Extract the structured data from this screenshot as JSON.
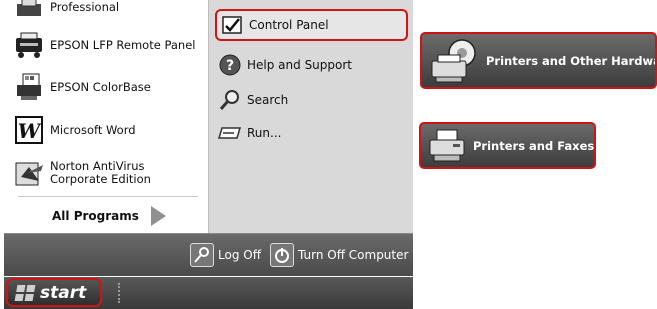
{
  "start_menu": {
    "programs": [
      {
        "label": "Professional",
        "icon": "printer-icon"
      },
      {
        "label": "EPSON LFP Remote Panel",
        "icon": "epson-lfp-icon"
      },
      {
        "label": "EPSON ColorBase",
        "icon": "epson-colorbase-icon"
      },
      {
        "label": "Microsoft Word",
        "icon": "word-icon"
      },
      {
        "label": "Norton AntiVirus Corporate Edition",
        "icon": "norton-icon"
      }
    ],
    "all_programs_label": "All Programs",
    "right_items": {
      "control_panel": "Control Panel",
      "help": "Help and Support",
      "search": "Search",
      "run": "Run..."
    },
    "log_off": "Log Off",
    "turn_off": "Turn Off Computer"
  },
  "taskbar": {
    "start_label": "start"
  },
  "control_panel": {
    "printers_hardware": "Printers and Other Hardware",
    "printers_faxes": "Printers and Faxes"
  },
  "colors": {
    "highlight_border": "#d01414",
    "dark_bar": "#4a4a4a"
  }
}
